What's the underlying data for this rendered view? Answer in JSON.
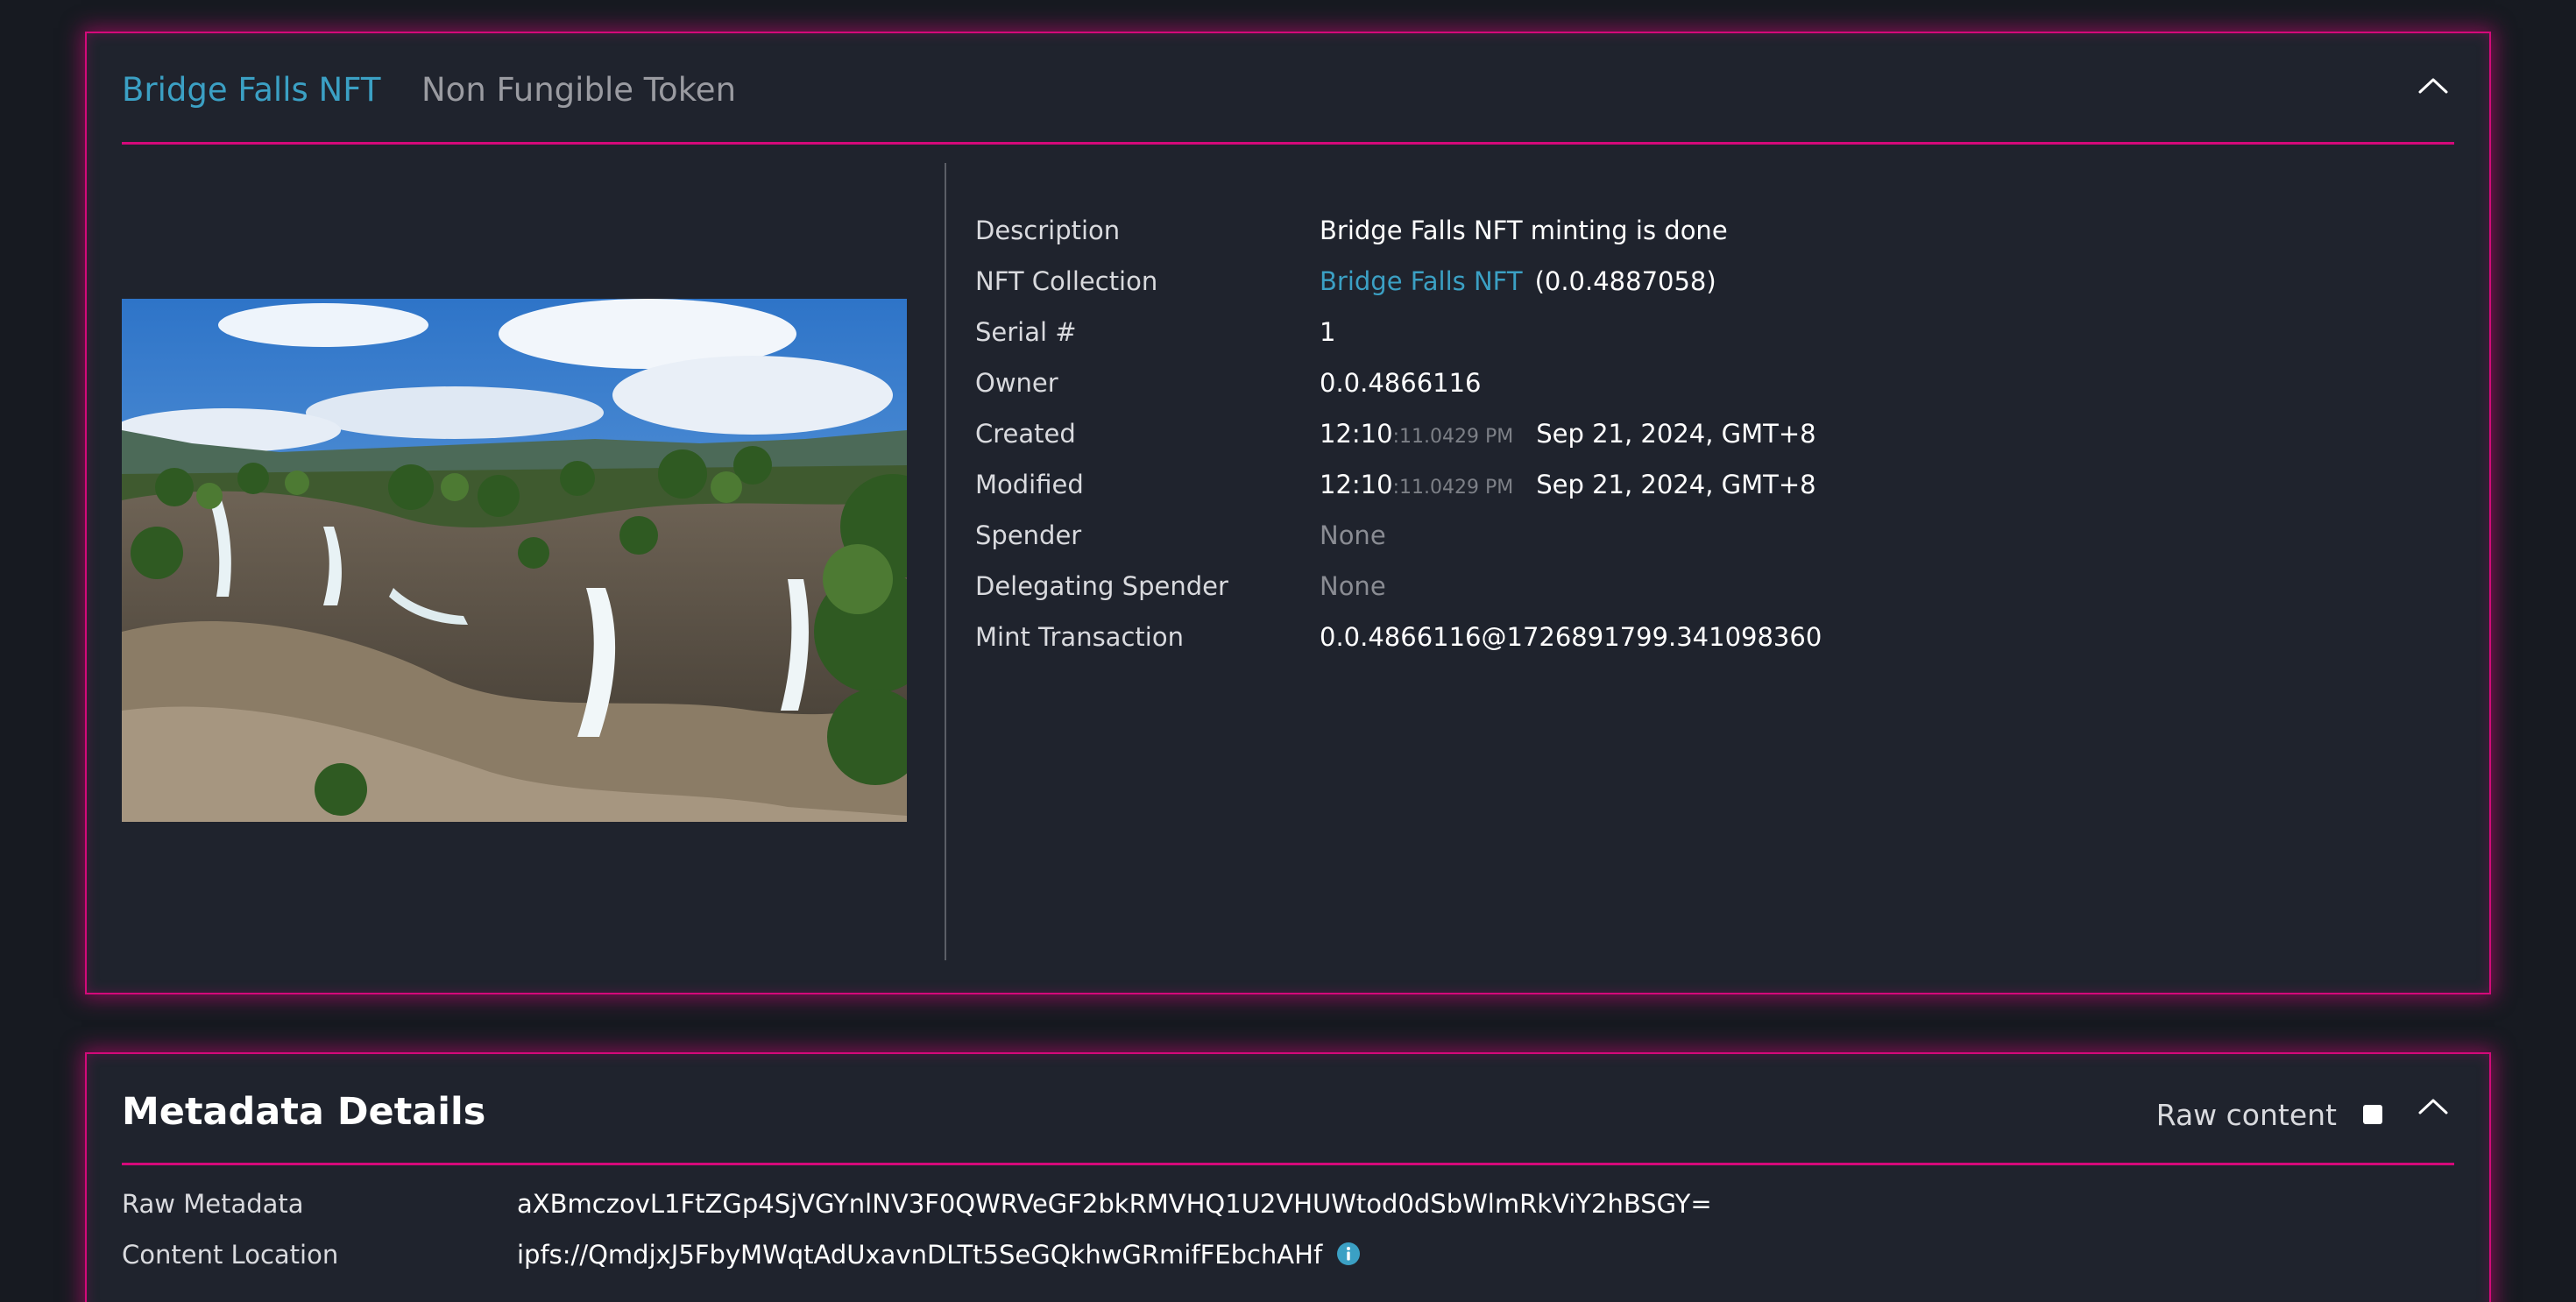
{
  "nft_panel": {
    "title": "Bridge Falls NFT",
    "subtitle": "Non Fungible Token",
    "image_alt": "waterfall-landscape-image",
    "properties": {
      "description": {
        "label": "Description",
        "value": "Bridge Falls NFT minting is done"
      },
      "collection": {
        "label": "NFT Collection",
        "link": "Bridge Falls NFT",
        "id": "(0.0.4887058)"
      },
      "serial": {
        "label": "Serial #",
        "value": "1"
      },
      "owner": {
        "label": "Owner",
        "value": "0.0.4866116"
      },
      "created": {
        "label": "Created",
        "time": "12:10",
        "seconds": ":11.0429 PM",
        "date": "Sep 21, 2024, GMT+8"
      },
      "modified": {
        "label": "Modified",
        "time": "12:10",
        "seconds": ":11.0429 PM",
        "date": "Sep 21, 2024, GMT+8"
      },
      "spender": {
        "label": "Spender",
        "value": "None"
      },
      "delegating_spender": {
        "label": "Delegating Spender",
        "value": "None"
      },
      "mint_transaction": {
        "label": "Mint Transaction",
        "value": "0.0.4866116@1726891799.341098360"
      }
    }
  },
  "metadata_panel": {
    "title": "Metadata Details",
    "raw_content_label": "Raw content",
    "raw_content_checked": false,
    "rows": {
      "raw_metadata": {
        "label": "Raw Metadata",
        "value": "aXBmczovL1FtZGp4SjVGYnlNV3F0QWRVeGF2bkRMVHQ1U2VHUWtod0dSbWlmRkViY2hBSGY="
      },
      "content_location": {
        "label": "Content Location",
        "value": "ipfs://QmdjxJ5FbyMWqtAdUxavnDLTt5SeGQkhwGRmifFEbchAHf"
      }
    }
  },
  "colors": {
    "accent_pink": "#d4097a",
    "link_blue": "#3ba0c4",
    "panel_bg": "#1f232d",
    "page_bg": "#171a21"
  }
}
